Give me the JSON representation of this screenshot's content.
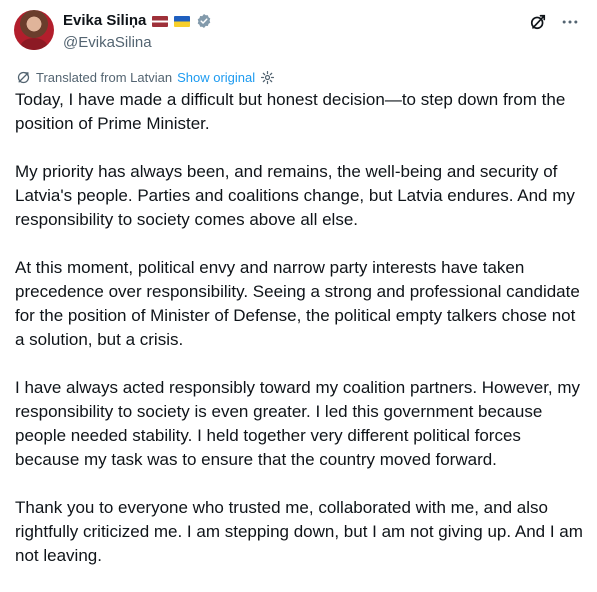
{
  "author": {
    "display_name": "Evika Siliņa",
    "handle": "@EvikaSilina",
    "flags": [
      "latvia-flag",
      "ukraine-flag"
    ],
    "verified_icon": "verified-badge-icon"
  },
  "actions": {
    "grok_icon": "grok-icon",
    "more_icon": "more-options-icon"
  },
  "translation": {
    "label": "Translated from Latvian",
    "show_original": "Show original"
  },
  "tweet": {
    "paragraphs": [
      "Today, I have made a difficult but honest decision—to step down from the position of Prime Minister.",
      "My priority has always been, and remains, the well-being and security of Latvia's people. Parties and coalitions change, but Latvia endures. And my responsibility to society comes above all else.",
      "At this moment, political envy and narrow party interests have taken precedence over responsibility. Seeing a strong and professional candidate for the position of Minister of Defense, the political empty talkers chose not a solution, but a crisis.",
      "I have always acted responsibly toward my coalition partners. However, my responsibility to society is even greater. I led this government because people needed stability. I held together very different political forces because my task was to ensure that the country moved forward.",
      "Thank you to everyone who trusted me, collaborated with me, and also rightfully criticized me. I am stepping down, but I am not giving up. And I am not leaving."
    ]
  },
  "colors": {
    "text": "#0f1419",
    "secondary": "#536471",
    "link": "#1d9bf0"
  }
}
